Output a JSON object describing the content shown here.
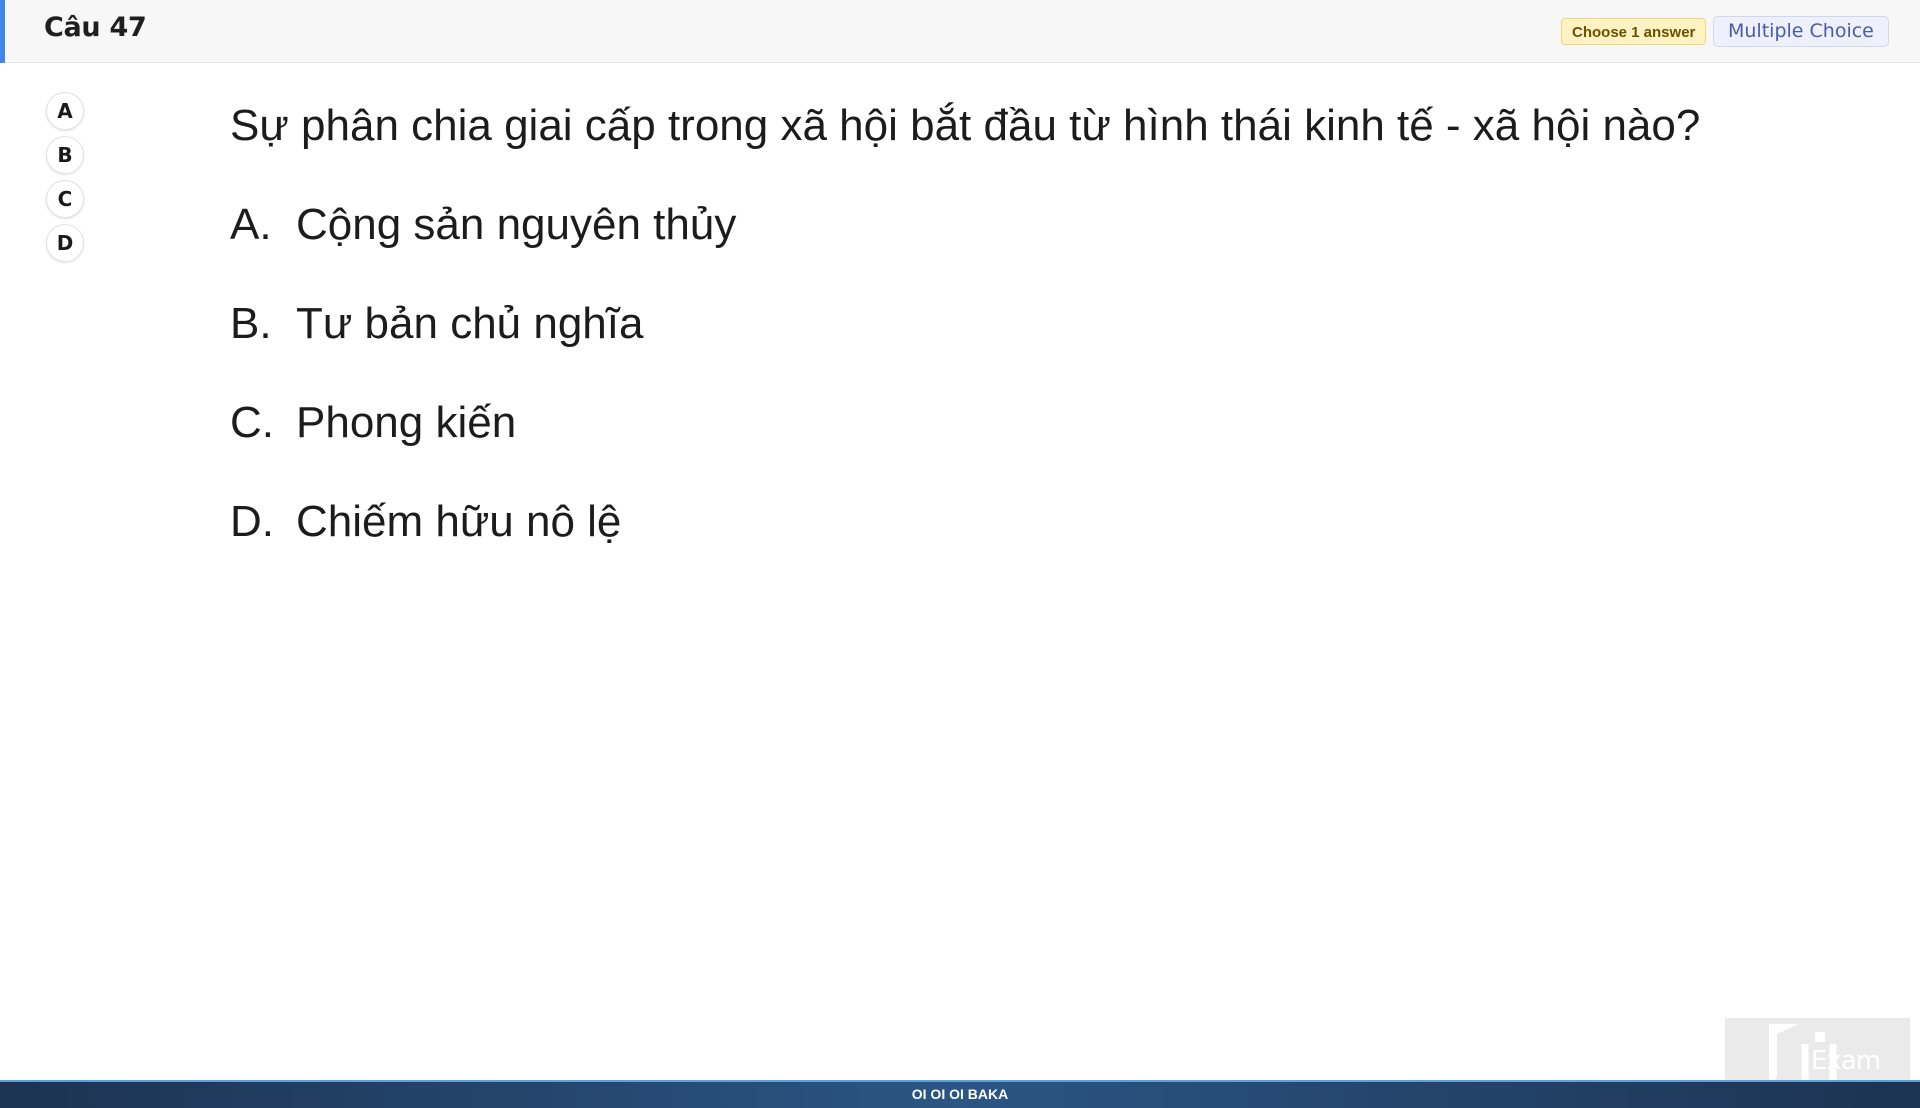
{
  "header": {
    "question_number": "Câu 47",
    "badge_choose": "Choose 1 answer",
    "badge_type": "Multiple Choice",
    "accent_color": "#3f86e6"
  },
  "selector": {
    "choices": [
      "A",
      "B",
      "C",
      "D"
    ]
  },
  "question": {
    "text": "Sự phân chia giai cấp trong xã hội bắt đầu từ hình thái kinh tế - xã hội nào?",
    "options": [
      {
        "letter": "A.",
        "text": "Cộng sản nguyên thủy"
      },
      {
        "letter": "B.",
        "text": "Tư bản chủ nghĩa"
      },
      {
        "letter": "C.",
        "text": "Phong kiến"
      },
      {
        "letter": "D.",
        "text": "Chiếm hữu nô lệ"
      }
    ]
  },
  "watermark": {
    "logo_text": "Exam",
    "icon": "fu-logo-icon"
  },
  "footer": {
    "text": "OI OI OI BAKA"
  }
}
